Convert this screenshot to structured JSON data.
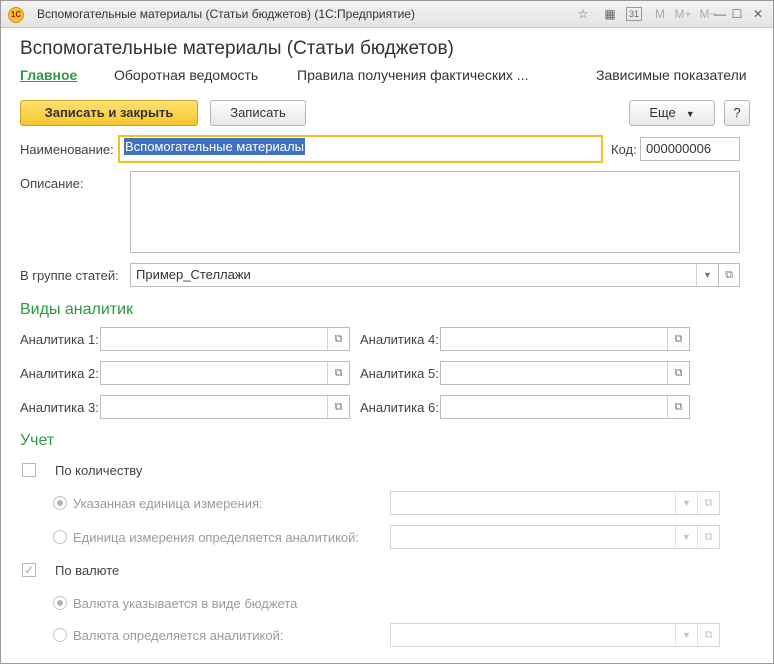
{
  "window": {
    "title": "Вспомогательные материалы (Статьи бюджетов)  (1С:Предприятие)",
    "logo_text": "1С",
    "icons": [
      "star-icon",
      "calculator-icon",
      "calendar-icon",
      "memory-m-icon",
      "memory-plus-icon",
      "memory-minus-icon",
      "minimize-icon",
      "maximize-icon",
      "close-icon"
    ],
    "icon_glyphs": {
      "star": "☆",
      "calc": "▦",
      "calendar": "31",
      "m": "M",
      "mplus": "M+",
      "mminus": "M−",
      "minimize": "—",
      "maximize": "☐",
      "close": "✕"
    }
  },
  "header": {
    "title": "Вспомогательные материалы (Статьи бюджетов)",
    "tabs": [
      "Главное",
      "Оборотная ведомость",
      "Правила получения фактических ...",
      "Зависимые показатели"
    ]
  },
  "toolbar": {
    "save_close": "Записать и закрыть",
    "save": "Записать",
    "more": "Еще",
    "help": "?"
  },
  "fields": {
    "name_label": "Наименование:",
    "name_value": "Вспомогательные материалы",
    "code_label": "Код:",
    "code_value": "000000006",
    "description_label": "Описание:",
    "description_value": "",
    "group_label": "В группе статей:",
    "group_value": "Пример_Стеллажи"
  },
  "analytics": {
    "section_title": "Виды аналитик",
    "items": [
      {
        "label": "Аналитика 1:",
        "value": ""
      },
      {
        "label": "Аналитика 2:",
        "value": ""
      },
      {
        "label": "Аналитика 3:",
        "value": ""
      },
      {
        "label": "Аналитика 4:",
        "value": ""
      },
      {
        "label": "Аналитика 5:",
        "value": ""
      },
      {
        "label": "Аналитика 6:",
        "value": ""
      }
    ]
  },
  "accounting": {
    "section_title": "Учет",
    "by_quantity": {
      "label": "По количеству",
      "checked": false
    },
    "unit_specified": {
      "label": "Указанная единица измерения:",
      "selected": true
    },
    "unit_by_analytics": {
      "label": "Единица измерения определяется аналитикой:",
      "selected": false
    },
    "by_currency": {
      "label": "По валюте",
      "checked": true
    },
    "currency_in_budget": {
      "label": "Валюта указывается в виде бюджета",
      "selected": true
    },
    "currency_by_analytics": {
      "label": "Валюта определяется аналитикой:",
      "selected": false
    }
  },
  "colors": {
    "accent_green": "#2c9a3f",
    "primary_button": "#f6c52d",
    "focus_border": "#f2c21f",
    "selection": "#3f73c2"
  }
}
